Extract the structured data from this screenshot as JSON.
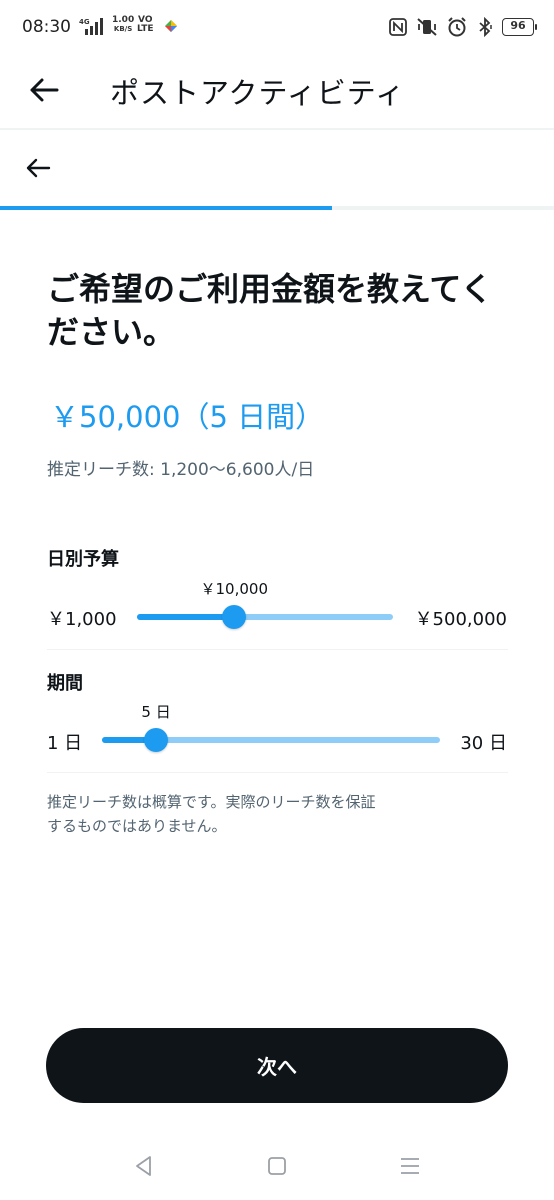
{
  "status_bar": {
    "time": "08:30",
    "network_type": "4G",
    "net_speed_value": "1.00",
    "net_speed_unit": "KB/S",
    "volte_top": "VO",
    "volte_bottom": "LTE",
    "battery": "96"
  },
  "header": {
    "title": "ポストアクティビティ"
  },
  "progress": {
    "fraction": 0.6
  },
  "main": {
    "question": "ご希望のご利用金額を教えてください。",
    "amount": "￥50,000（5 日間）",
    "reach": "推定リーチ数: 1,200〜6,600人/日"
  },
  "daily_budget": {
    "label": "日別予算",
    "min_label": "￥1,000",
    "max_label": "￥500,000",
    "current_label": "￥10,000",
    "position": 0.38
  },
  "duration": {
    "label": "期間",
    "min_label": "1 日",
    "max_label": "30 日",
    "current_label": "5 日",
    "position": 0.16
  },
  "disclaimer": "推定リーチ数は概算です。実際のリーチ数を保証するものではありません。",
  "next_button": {
    "label": "次へ"
  },
  "colors": {
    "accent": "#1d9bf0",
    "accent_light": "#8ecdf8",
    "button_dark": "#0f1419"
  }
}
